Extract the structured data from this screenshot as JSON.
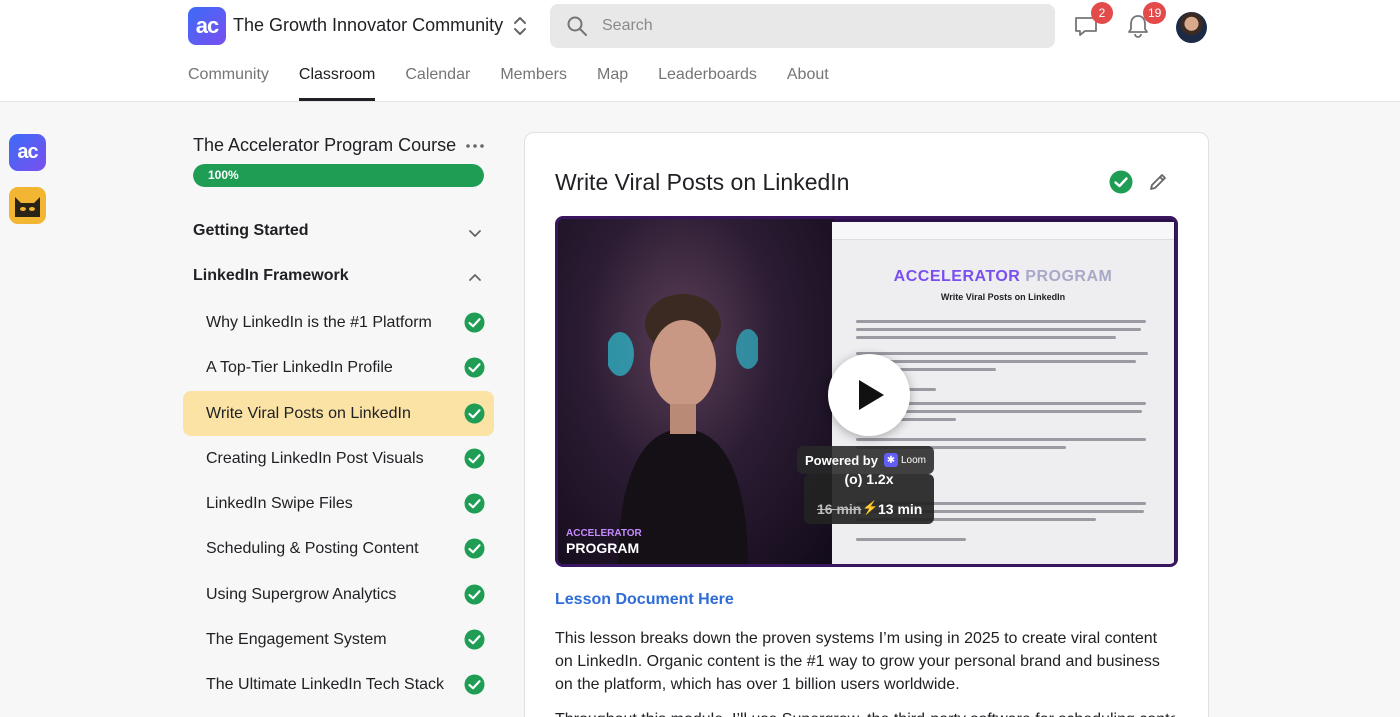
{
  "header": {
    "logo_text": "ac",
    "community_name": "The Growth Innovator Community",
    "search_placeholder": "Search",
    "chat_badge": "2",
    "notifications_badge": "19"
  },
  "nav": {
    "tabs": [
      "Community",
      "Classroom",
      "Calendar",
      "Members",
      "Map",
      "Leaderboards",
      "About"
    ],
    "active": "Classroom"
  },
  "rail": {
    "app1_text": "ac"
  },
  "course": {
    "title": "The Accelerator Program Course",
    "progress_percent": 100,
    "progress_label": "100%",
    "sections": [
      {
        "title": "Getting Started",
        "expanded": false
      },
      {
        "title": "LinkedIn Framework",
        "expanded": true
      }
    ],
    "lessons": [
      {
        "label": "Why LinkedIn is the #1 Platform",
        "done": true
      },
      {
        "label": "A Top-Tier LinkedIn Profile",
        "done": true
      },
      {
        "label": "Write Viral Posts on LinkedIn",
        "done": true,
        "active": true
      },
      {
        "label": "Creating LinkedIn Post Visuals",
        "done": true
      },
      {
        "label": "LinkedIn Swipe Files",
        "done": true
      },
      {
        "label": "Scheduling & Posting Content",
        "done": true
      },
      {
        "label": "Using Supergrow Analytics",
        "done": true
      },
      {
        "label": "The Engagement System",
        "done": true
      },
      {
        "label": "The Ultimate LinkedIn Tech Stack",
        "done": true
      }
    ]
  },
  "lesson": {
    "title": "Write Viral Posts on LinkedIn",
    "video": {
      "doc_title_part1": "ACCELERATOR",
      "doc_title_part2": " PROGRAM",
      "doc_subtitle": "Write Viral Posts on LinkedIn",
      "watermark_line1": "ACCELERATOR",
      "watermark_line2": "PROGRAM",
      "powered_by": "Powered by",
      "loom_label": "Loom",
      "speed_top": "(o) 1.2x",
      "old_duration": "16 min",
      "new_duration": "13 min"
    },
    "doc_link": "Lesson Document Here",
    "description": "This lesson breaks down the proven systems I’m using in 2025 to create viral content on LinkedIn. Organic content is the #1 way to grow your personal brand and business on the platform, which has over 1 billion users worldwide.",
    "description_2": "Throughout this module, I’ll use Supergrow, the third-party software for scheduling content"
  },
  "colors": {
    "accent": "#7a4ff0",
    "progress": "#1f9d55",
    "active_lesson_bg": "#fbe3a6",
    "link": "#2e6cd6",
    "badge": "#e34b4b"
  },
  "icons": [
    "search-icon",
    "chevron-updown-icon",
    "chat-icon",
    "bell-icon",
    "more-icon",
    "chevron-down-icon",
    "chevron-up-icon",
    "check-circle-icon",
    "pencil-icon",
    "play-icon"
  ]
}
